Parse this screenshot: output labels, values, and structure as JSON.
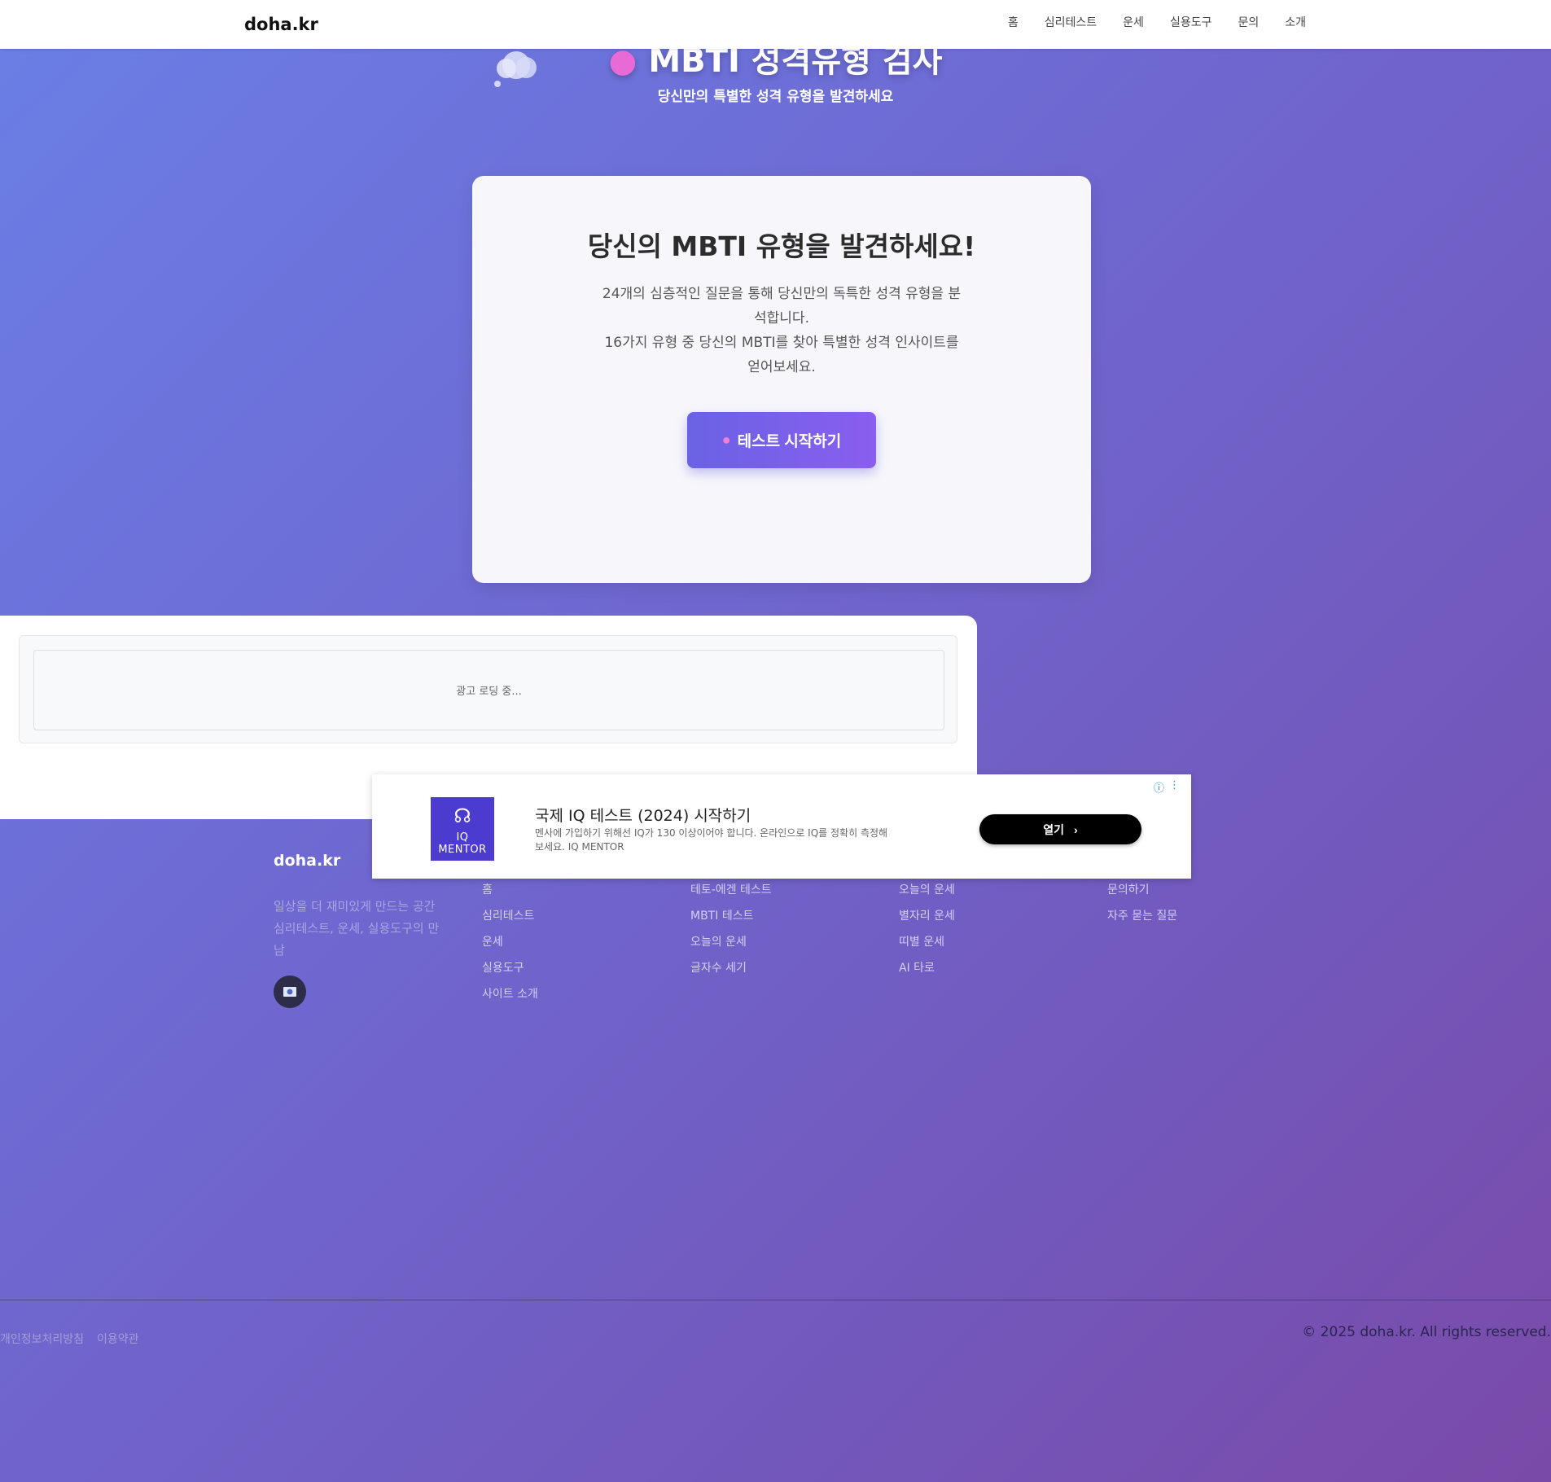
{
  "header": {
    "logo": "doha.kr",
    "nav": [
      "홈",
      "심리테스트",
      "운세",
      "실용도구",
      "문의",
      "소개"
    ]
  },
  "hero": {
    "title": "MBTI 성격유형 검사",
    "subtitle": "당신만의 특별한 성격 유형을 발견하세요"
  },
  "card": {
    "title": "당신의 MBTI 유형을 발견하세요!",
    "desc_line1": "24개의 심층적인 질문을 통해 당신만의 독특한 성격 유형을 분석합니다.",
    "desc_line2": "16가지 유형 중 당신의 MBTI를 찾아 특별한 성격 인사이트를 얻어보세요.",
    "start_button": "테스트 시작하기"
  },
  "ad_placeholder": "광고 로딩 중...",
  "ad_banner": {
    "logo_text": "IQ MENTOR",
    "title": "국제 IQ 테스트 (2024) 시작하기",
    "text": "멘사에 가입하기 위해선 IQ가 130 이상이어야 합니다. 온라인으로 IQ를 정확히 측정해보세요. IQ MENTOR",
    "open_button": "열기"
  },
  "footer": {
    "logo": "doha.kr",
    "tagline": "일상을 더 재미있게 만드는 공간 심리테스트, 운세, 실용도구의 만남",
    "col1": [
      "홈",
      "심리테스트",
      "운세",
      "실용도구",
      "사이트 소개"
    ],
    "col2": [
      "테토-에겐 테스트",
      "MBTI 테스트",
      "오늘의 운세",
      "글자수 세기"
    ],
    "col3": [
      "오늘의 운세",
      "별자리 운세",
      "띠별 운세",
      "AI 타로"
    ],
    "col4": [
      "문의하기",
      "자주 묻는 질문"
    ],
    "bottom_links": [
      "개인정보처리방침",
      "이용약관"
    ],
    "copyright": "© 2025 doha.kr. All rights reserved."
  },
  "colors": {
    "accent": "#6a62e4",
    "accent_end": "#8a5ef0",
    "ad_brand": "#4b3ccf"
  }
}
